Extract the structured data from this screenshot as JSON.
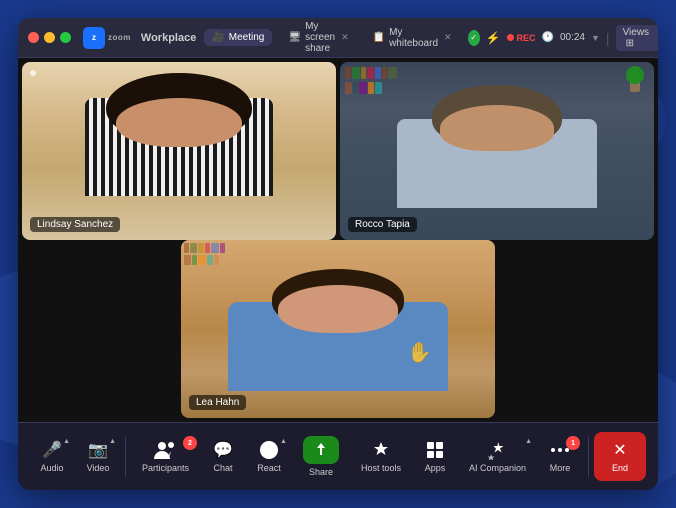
{
  "app": {
    "title": "Zoom Workplace",
    "logo_text": "zoom",
    "workplace_label": "Workplace"
  },
  "titlebar": {
    "traffic_lights": [
      "red",
      "yellow",
      "green"
    ],
    "tabs": [
      {
        "id": "meeting",
        "label": "Meeting",
        "icon": "📹",
        "active": true,
        "closeable": false
      },
      {
        "id": "screen_share",
        "label": "My screen share",
        "icon": "🖥",
        "active": false,
        "closeable": true
      },
      {
        "id": "whiteboard",
        "label": "My whiteboard",
        "icon": "📋",
        "active": false,
        "closeable": true
      }
    ],
    "shield_color": "#28a745",
    "rec_label": "REC",
    "timer": "00:24",
    "views_label": "Views"
  },
  "participants": [
    {
      "id": 1,
      "name": "Lindsay Sanchez",
      "position": "top-left"
    },
    {
      "id": 2,
      "name": "Rocco Tapia",
      "position": "top-right"
    },
    {
      "id": 3,
      "name": "Lea Hahn",
      "position": "bottom-center"
    }
  ],
  "controls": [
    {
      "id": "audio",
      "label": "Audio",
      "icon": "🎤",
      "has_caret": true
    },
    {
      "id": "video",
      "label": "Video",
      "icon": "📷",
      "has_caret": true
    },
    {
      "id": "participants",
      "label": "Participants",
      "icon": "👥",
      "has_caret": false,
      "badge": "2"
    },
    {
      "id": "chat",
      "label": "Chat",
      "icon": "💬",
      "has_caret": false
    },
    {
      "id": "react",
      "label": "React",
      "icon": "❤️",
      "has_caret": true
    },
    {
      "id": "share",
      "label": "Share",
      "icon": "⬆",
      "has_caret": false,
      "highlighted": true
    },
    {
      "id": "host_tools",
      "label": "Host tools",
      "icon": "🛡",
      "has_caret": false
    },
    {
      "id": "apps",
      "label": "Apps",
      "icon": "⊞",
      "has_caret": false
    },
    {
      "id": "ai_companion",
      "label": "AI Companion",
      "icon": "✨",
      "has_caret": true
    },
    {
      "id": "more",
      "label": "More",
      "icon": "···",
      "has_caret": false,
      "badge": "1"
    },
    {
      "id": "end",
      "label": "End",
      "icon": "✕",
      "has_caret": false,
      "danger": true
    }
  ]
}
